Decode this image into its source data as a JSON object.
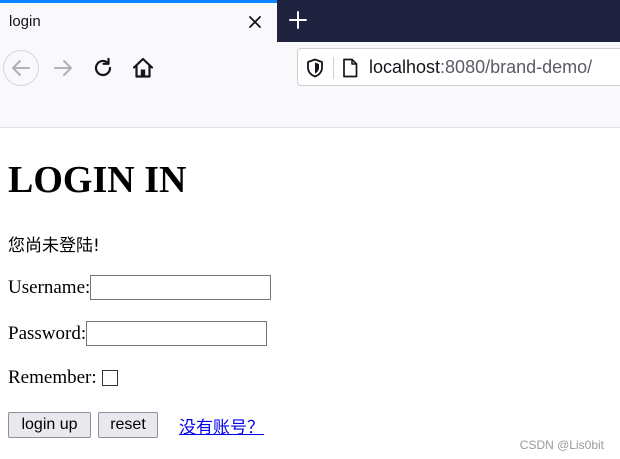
{
  "browser": {
    "tab_title": "login",
    "url_host": "localhost",
    "url_rest": ":8080/brand-demo/",
    "accent_color": "#0a84ff",
    "tabbar_color": "#1f2340"
  },
  "page": {
    "title": "LOGIN IN",
    "status_message": "您尚未登陆!",
    "username_label": "Username:",
    "password_label": "Password:",
    "remember_label": "Remember:",
    "username_value": "",
    "password_value": "",
    "remember_checked": false,
    "login_button": "login up",
    "reset_button": "reset",
    "register_link": "没有账号？"
  },
  "watermark": "CSDN @Lis0bit"
}
